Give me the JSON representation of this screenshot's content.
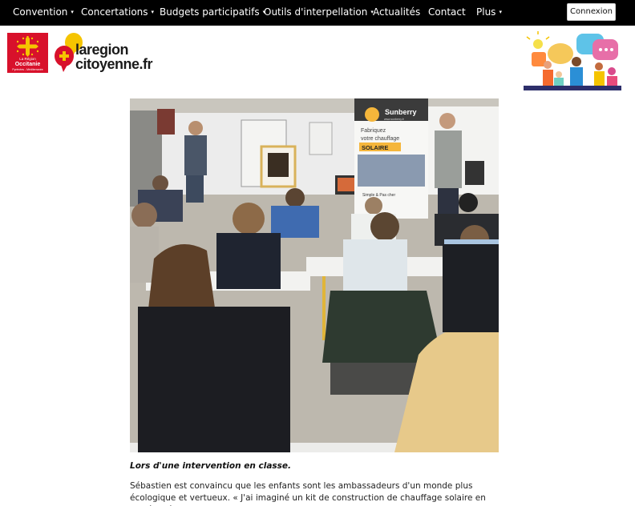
{
  "nav": {
    "items": [
      {
        "label": "Convention",
        "caret": true
      },
      {
        "label": "Concertations",
        "caret": true
      },
      {
        "label": "Budgets participatifs",
        "caret": true
      },
      {
        "label": "Outils d'interpellation",
        "caret": true
      },
      {
        "label": "Actualités",
        "caret": false
      },
      {
        "label": "Contact",
        "caret": false
      },
      {
        "label": "Plus",
        "caret": true
      }
    ],
    "login_label": "Connexion"
  },
  "header": {
    "region_logo": {
      "line1": "La Région",
      "line2": "Occitanie",
      "line3": "Pyrénées - Méditerranée"
    },
    "brand": {
      "line1": "laregion",
      "line2": "citoyenne.fr"
    }
  },
  "photo": {
    "banner_brand": "Sunberry",
    "banner_url": "www.sunberry.fr",
    "banner_line1": "Fabriquez",
    "banner_line2": "votre chauffage",
    "banner_line3": "SOLAIRE",
    "banner_line4": "Simple & Pas cher"
  },
  "article": {
    "caption": "Lors d'une intervention en classe.",
    "paragraph": "Sébastien est convaincu que les enfants sont les ambassadeurs d'un monde plus écologique et vertueux. « J'ai imaginé un kit de construction de chauffage solaire en modèle réduit pour"
  },
  "colors": {
    "nav_bg": "#000000",
    "region_red": "#d8112b",
    "brand_yellow": "#f5c400",
    "brand_red": "#d8112b"
  }
}
